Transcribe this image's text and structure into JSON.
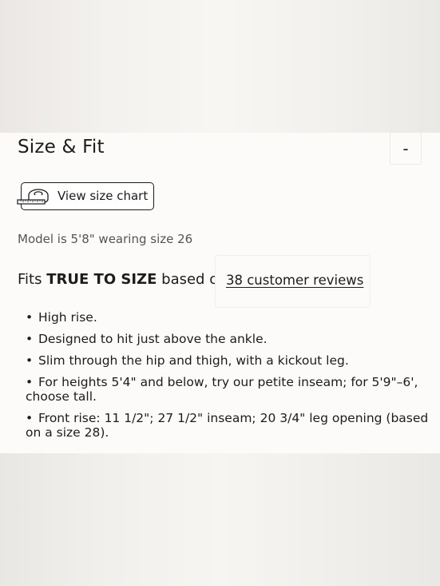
{
  "section": {
    "title": "Size & Fit",
    "collapse_label": "-"
  },
  "size_chart": {
    "label": "View size chart",
    "icon": "tape-measure-icon"
  },
  "model_note": "Model is 5'8\" wearing size 26",
  "fit": {
    "prefix": "Fits",
    "emphasis": "TRUE TO SIZE",
    "suffix": "based on",
    "reviews_link": "38 customer reviews"
  },
  "details": [
    "High rise.",
    "Designed to hit just above the ankle.",
    "Slim through the hip and thigh, with a kickout leg.",
    "For heights 5'4\" and below, try our petite inseam; for 5'9\"–6', choose tall.",
    "Front rise: 11 1/2\"; 27 1/2\" inseam; 20 3/4\" leg opening (based on a size 28)."
  ]
}
